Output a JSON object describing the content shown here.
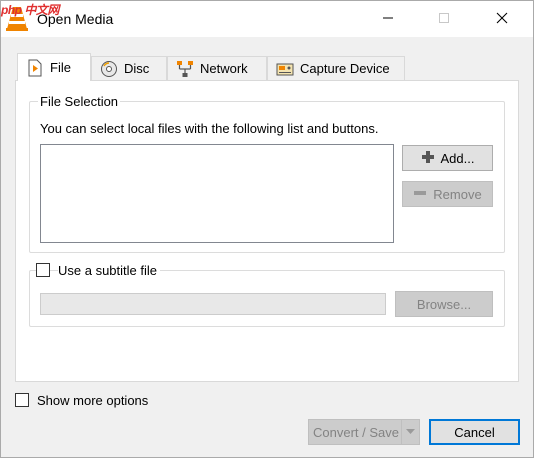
{
  "window": {
    "title": "Open Media",
    "watermark": "php 中文网",
    "icon": "vlc-cone-icon",
    "controls": {
      "minimize": "minimize-icon",
      "maximize": "maximize-icon",
      "close": "close-icon"
    }
  },
  "tabs": [
    {
      "label": "File",
      "icon": "file-icon",
      "active": true
    },
    {
      "label": "Disc",
      "icon": "disc-icon",
      "active": false
    },
    {
      "label": "Network",
      "icon": "network-icon",
      "active": false
    },
    {
      "label": "Capture Device",
      "icon": "capture-device-icon",
      "active": false
    }
  ],
  "file_selection": {
    "legend": "File Selection",
    "description": "You can select local files with the following list and buttons.",
    "add_label": "Add...",
    "remove_label": "Remove"
  },
  "subtitle": {
    "checkbox_label": "Use a subtitle file",
    "checked": false,
    "input_value": "",
    "browse_label": "Browse..."
  },
  "bottom": {
    "show_more_label": "Show more options",
    "show_more_checked": false,
    "convert_label": "Convert / Save",
    "cancel_label": "Cancel"
  },
  "colors": {
    "accent": "#0078d7",
    "vlc_orange": "#f08400",
    "disabled_text": "#838383"
  }
}
